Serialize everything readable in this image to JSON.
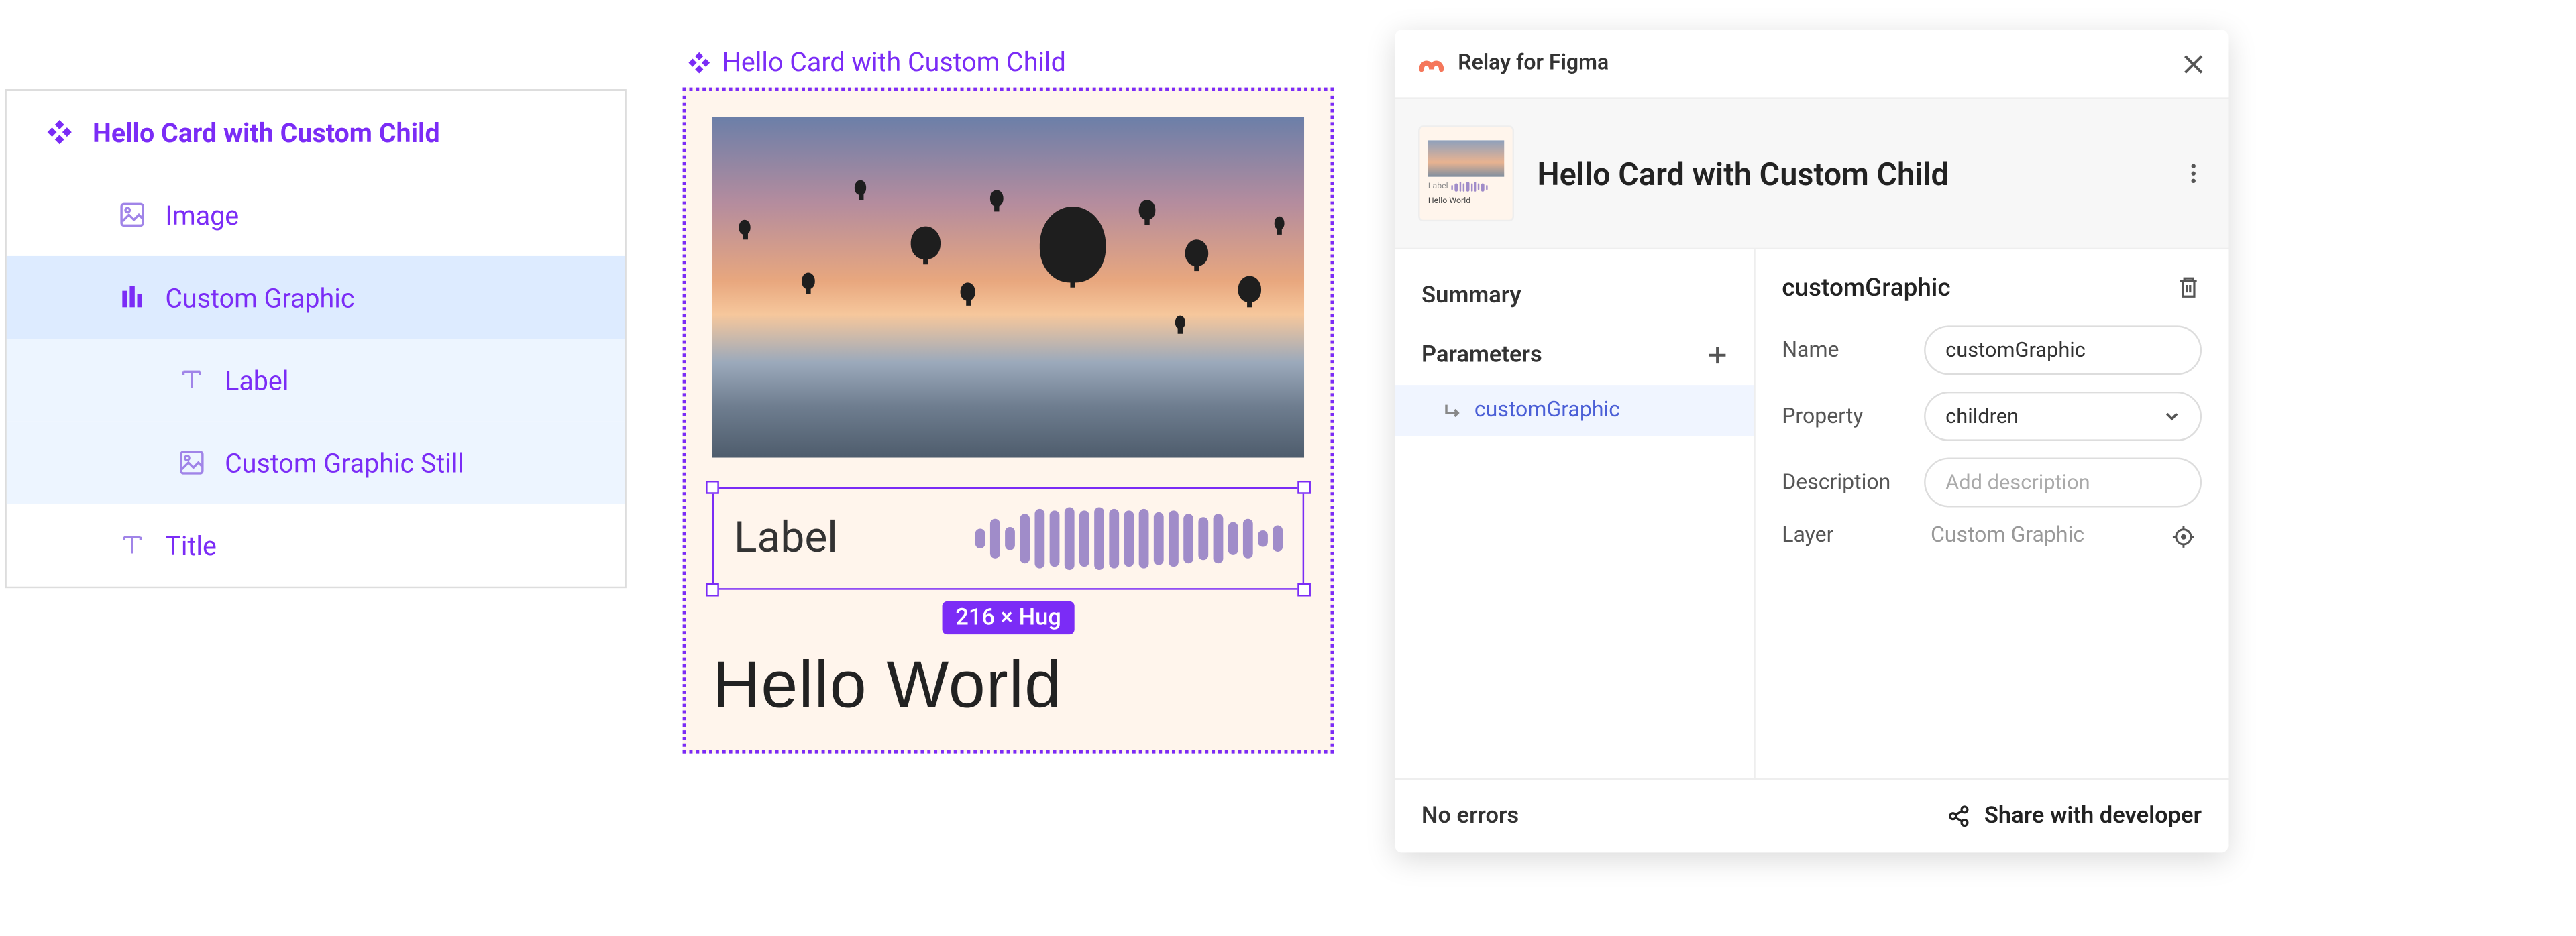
{
  "layers": {
    "header": "Hello Card with Custom Child",
    "items": [
      {
        "label": "Image"
      },
      {
        "label": "Custom Graphic"
      },
      {
        "label": "Label"
      },
      {
        "label": "Custom Graphic Still"
      },
      {
        "label": "Title"
      }
    ]
  },
  "canvas": {
    "component_title": "Hello Card with Custom Child",
    "mid_label": "Label",
    "size_badge": "216 × Hug",
    "card_title": "Hello World"
  },
  "plugin": {
    "brand_name": "Relay for Figma",
    "component_name": "Hello Card with Custom Child",
    "thumb_label": "Label",
    "thumb_title": "Hello World",
    "left": {
      "summary": "Summary",
      "parameters": "Parameters",
      "param_items": [
        {
          "name": "customGraphic"
        }
      ]
    },
    "right": {
      "title": "customGraphic",
      "fields": {
        "name_label": "Name",
        "name_value": "customGraphic",
        "property_label": "Property",
        "property_value": "children",
        "description_label": "Description",
        "description_placeholder": "Add description",
        "layer_label": "Layer",
        "layer_value": "Custom Graphic"
      }
    },
    "footer": {
      "status": "No errors",
      "share": "Share with developer"
    }
  }
}
